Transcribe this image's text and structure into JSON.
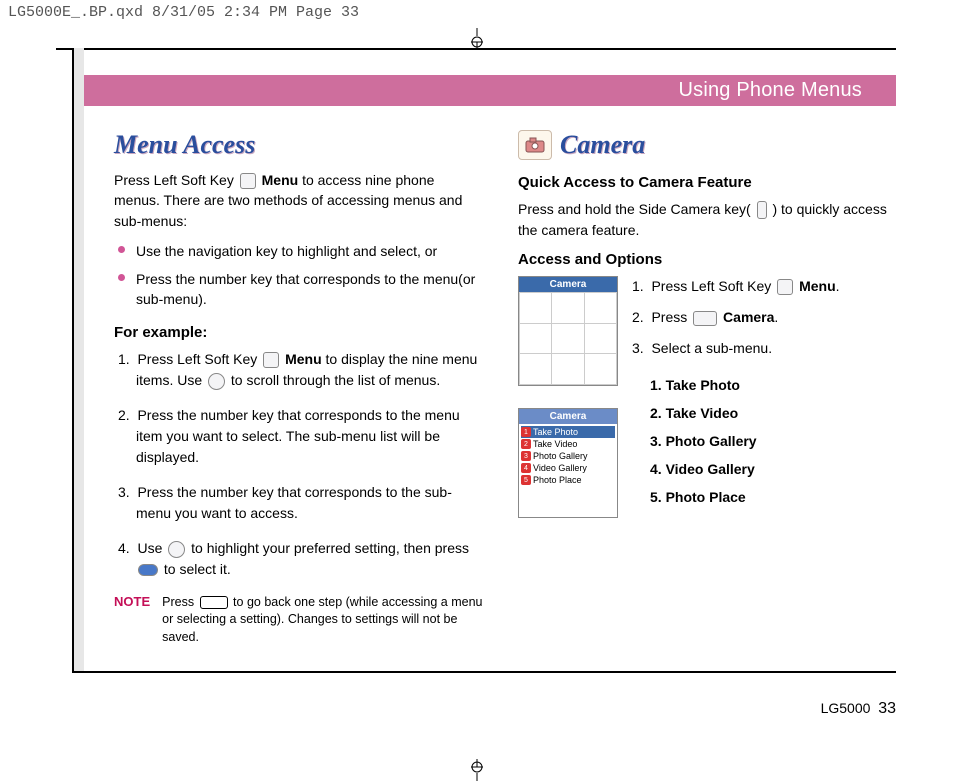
{
  "print_header": "LG5000E_.BP.qxd  8/31/05  2:34 PM  Page 33",
  "header_bar": "Using Phone Menus",
  "left": {
    "title": "Menu Access",
    "intro_pre": "Press Left Soft Key ",
    "intro_bold": "Menu",
    "intro_post": " to access nine phone menus. There are two methods of accessing menus and sub-menus:",
    "bullets": [
      "Use the navigation key to highlight and select, or",
      "Press the number key that corresponds to the menu(or sub-menu)."
    ],
    "example_head": "For example:",
    "steps": [
      {
        "n": "1.",
        "pre": "Press Left Soft Key ",
        "bold": "Menu",
        "post": " to display the nine menu items. Use ",
        "post2": " to scroll through the list of menus."
      },
      {
        "n": "2.",
        "text": "Press the number key that corresponds to the menu item you want to select. The sub-menu list will be displayed."
      },
      {
        "n": "3.",
        "text": "Press the number key that corresponds to the sub-menu you want to access."
      },
      {
        "n": "4.",
        "pre": "Use ",
        "post": " to highlight your preferred setting, then press ",
        "post2": " to select it."
      }
    ],
    "note_label": "NOTE",
    "note_pre": "Press ",
    "note_post": " to go back one step (while accessing a menu or selecting a setting). Changes to settings will not be saved."
  },
  "right": {
    "title": "Camera",
    "quick_head": "Quick Access to Camera Feature",
    "quick_pre": "Press and hold the Side Camera key( ",
    "quick_post": " ) to quickly access the camera feature.",
    "access_head": "Access and Options",
    "steps": [
      {
        "n": "1.",
        "pre": "Press Left Soft Key ",
        "bold": "Menu",
        "post": "."
      },
      {
        "n": "2.",
        "pre": "Press ",
        "bold": "Camera",
        "post": "."
      },
      {
        "n": "3.",
        "text": "Select a sub-menu."
      }
    ],
    "submenu": [
      "1. Take Photo",
      "2. Take Video",
      "3. Photo Gallery",
      "4. Video Gallery",
      "5. Photo Place"
    ],
    "shot1_title": "Camera",
    "shot2_title": "Camera",
    "shot2_items": [
      "Take Photo",
      "Take Video",
      "Photo Gallery",
      "Video Gallery",
      "Photo Place"
    ]
  },
  "footer_model": "LG5000",
  "footer_page": "33"
}
